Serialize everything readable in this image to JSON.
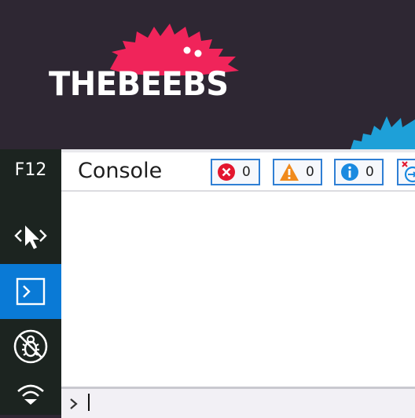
{
  "banner": {
    "brand_name": "THEBEEBS",
    "brand_color": "#ffffff",
    "mascot_color": "#f0245a",
    "accent_mascot_color": "#1ea0d8",
    "background_color": "#2e2733"
  },
  "devtools": {
    "window_label": "F12",
    "sidebar": {
      "items": [
        {
          "id": "dom-explorer",
          "icon": "dom-explorer-icon"
        },
        {
          "id": "console",
          "icon": "console-icon",
          "selected": true
        },
        {
          "id": "debugger",
          "icon": "debugger-icon"
        },
        {
          "id": "network",
          "icon": "network-icon"
        }
      ],
      "selected_color": "#0a7ad6"
    },
    "tool_title": "Console",
    "filters": {
      "errors": {
        "icon": "error-icon",
        "count": "0"
      },
      "warnings": {
        "icon": "warning-icon",
        "count": "0"
      },
      "info": {
        "icon": "info-icon",
        "count": "0"
      }
    },
    "clear_icon": "clear-console-icon",
    "input": {
      "value": "",
      "placeholder": ""
    }
  }
}
